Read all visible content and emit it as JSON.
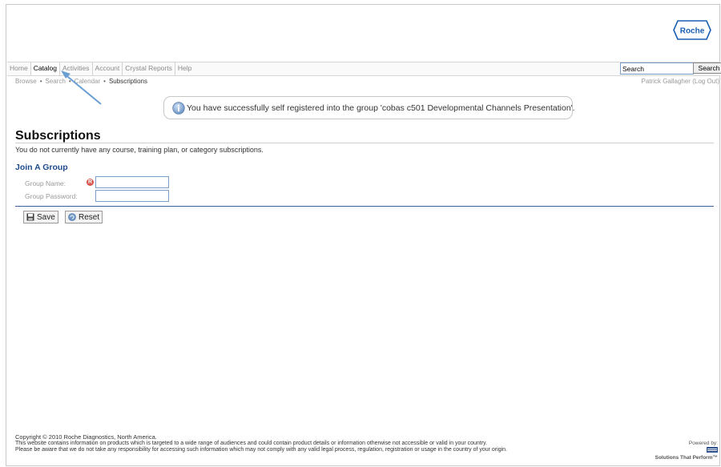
{
  "nav": {
    "tabs": [
      "Home",
      "Catalog",
      "Activities",
      "Account",
      "Crystal Reports",
      "Help"
    ],
    "active_tab": "Catalog",
    "search_value": "Search",
    "search_button": "Search"
  },
  "subnav": {
    "items": [
      "Browse",
      "Search",
      "Calendar",
      "Subscriptions"
    ],
    "separator": "•"
  },
  "user": {
    "name": "Patrick Gallagher",
    "logout": "(Log Out)"
  },
  "message": {
    "text": "You have successfully self registered into the group 'cobas c501 Developmental Channels Presentation'."
  },
  "page": {
    "title": "Subscriptions",
    "notice": "You do not currently have any course, training plan, or category subscriptions."
  },
  "join": {
    "title": "Join A Group",
    "group_name_label": "Group Name:",
    "group_password_label": "Group Password:",
    "group_name_value": "",
    "group_password_value": "",
    "required_mark": "R"
  },
  "buttons": {
    "save": "Save",
    "reset": "Reset"
  },
  "footer": {
    "copyright": "Copyright © 2010 Roche Diagnostics, North America.",
    "line1": "This website contains information on products which is targeted to a wide range of audiences and could contain product details or information otherwise not accessible or valid in your country.",
    "line2": "Please be aware that we do not take any responsibility for accessing such information which may not comply with any valid legal process, regulation, registration or usage in the country of your origin.",
    "powered_by": "Powered by:",
    "powered_tagline": "Solutions That Perform™"
  },
  "brand": {
    "logo_text": "Roche",
    "logo_color": "#1a5eb3"
  }
}
